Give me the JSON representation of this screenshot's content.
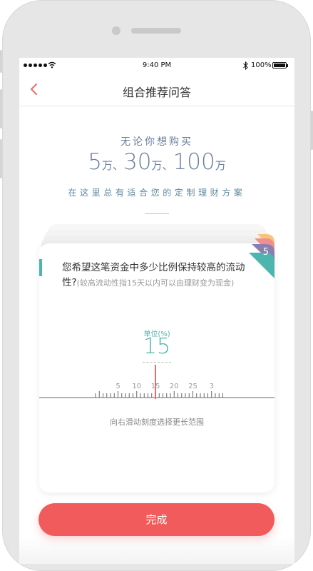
{
  "status_bar": {
    "time": "9:40 PM",
    "battery": "100%",
    "bluetooth": "∦"
  },
  "nav": {
    "title": "组合推荐问答",
    "back_icon": "chevron-left-icon"
  },
  "hero": {
    "line1": "无论你想购买",
    "amounts": [
      {
        "value": "5",
        "unit": "万、"
      },
      {
        "value": "30",
        "unit": "万、"
      },
      {
        "value": "100",
        "unit": "万"
      }
    ],
    "line2": "在这里总有适合您的定制理财方案"
  },
  "card": {
    "step": "5",
    "question": "您希望这笔资金中多少比例保持较高的流动性?",
    "hint": "(较高流动性指15天以内可以由理财变为现金)",
    "unit_label": "单位(%)",
    "value": 15,
    "ruler_labels": [
      "5",
      "10",
      "15",
      "20",
      "25",
      "3"
    ],
    "ruler_hint": "向右滑动刻度选择更长范围"
  },
  "done_button": "完成",
  "colors": {
    "accent": "#4cb5ad",
    "button": "#f25b5b",
    "hero_text": "#6b7f9e",
    "stack": [
      "#f7c47a",
      "#f08f8f",
      "#8a7fb0",
      "#4cb5ad"
    ]
  }
}
